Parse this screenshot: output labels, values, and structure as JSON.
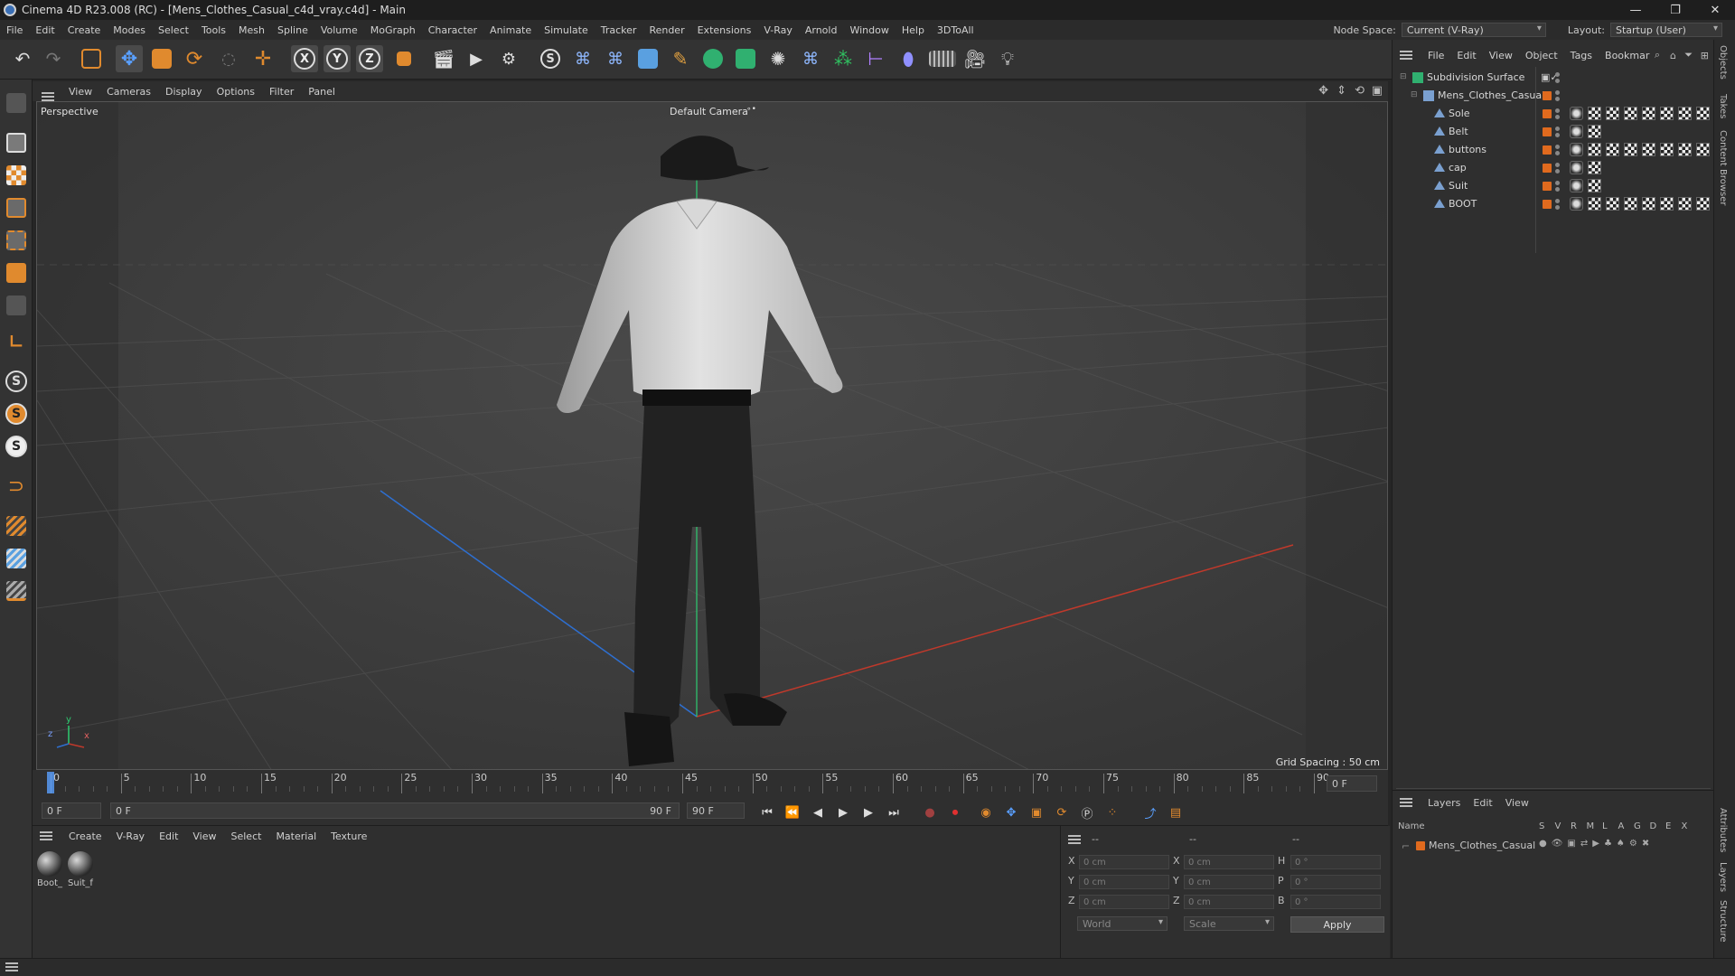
{
  "window": {
    "title": "Cinema 4D R23.008 (RC) - [Mens_Clothes_Casual_c4d_vray.c4d] - Main",
    "minimize": "—",
    "restore": "❐",
    "close": "✕"
  },
  "menubar": {
    "items": [
      "File",
      "Edit",
      "Create",
      "Modes",
      "Select",
      "Tools",
      "Mesh",
      "Spline",
      "Volume",
      "MoGraph",
      "Character",
      "Animate",
      "Simulate",
      "Tracker",
      "Render",
      "Extensions",
      "V-Ray",
      "Arnold",
      "Window",
      "Help",
      "3DToAll"
    ],
    "node_space_label": "Node Space:",
    "node_space_value": "Current (V-Ray)",
    "layout_label": "Layout:",
    "layout_value": "Startup (User)"
  },
  "toolbar": {
    "axis_x": "X",
    "axis_y": "Y",
    "axis_z": "Z"
  },
  "lefttoolbar": {
    "s1": "S",
    "s2": "S",
    "s3": "S"
  },
  "viewport": {
    "menu": [
      "View",
      "Cameras",
      "Display",
      "Options",
      "Filter",
      "Panel"
    ],
    "view_name": "Perspective",
    "camera_label": "Default Camera",
    "camera_suffix": "∘•",
    "grid_spacing": "Grid Spacing : 50 cm",
    "axis_y": "y",
    "axis_z": "z",
    "axis_x": "x"
  },
  "timeline": {
    "ticks": [
      "0",
      "5",
      "10",
      "15",
      "20",
      "25",
      "30",
      "35",
      "40",
      "45",
      "50",
      "55",
      "60",
      "65",
      "70",
      "75",
      "80",
      "85",
      "90"
    ],
    "current_frame": "0 F",
    "start_field": "0 F",
    "range_start": "0 F",
    "range_end": "90 F",
    "end_field": "90 F"
  },
  "materials": {
    "menu": [
      "Create",
      "V-Ray",
      "Edit",
      "View",
      "Select",
      "Material",
      "Texture"
    ],
    "items": [
      {
        "label": "Boot_"
      },
      {
        "label": "Suit_f"
      }
    ]
  },
  "coordinates": {
    "header": [
      "--",
      "--",
      "--"
    ],
    "rows": [
      {
        "axis": "X",
        "pos": "0 cm",
        "axis2": "X",
        "size": "0 cm",
        "rot_axis": "H",
        "rot": "0 °"
      },
      {
        "axis": "Y",
        "pos": "0 cm",
        "axis2": "Y",
        "size": "0 cm",
        "rot_axis": "P",
        "rot": "0 °"
      },
      {
        "axis": "Z",
        "pos": "0 cm",
        "axis2": "Z",
        "size": "0 cm",
        "rot_axis": "B",
        "rot": "0 °"
      }
    ],
    "mode": "World",
    "transform": "Scale",
    "apply_label": "Apply"
  },
  "objects": {
    "menu": [
      "File",
      "Edit",
      "View",
      "Object",
      "Tags",
      "Bookmar"
    ],
    "items": [
      {
        "name": "Subdivision Surface",
        "level": 0
      },
      {
        "name": "Mens_Clothes_Casual",
        "level": 1
      },
      {
        "name": "Sole",
        "level": 2,
        "tags": 8
      },
      {
        "name": "Belt",
        "level": 2,
        "tags": 2
      },
      {
        "name": "buttons",
        "level": 2,
        "tags": 8
      },
      {
        "name": "cap",
        "level": 2,
        "tags": 2
      },
      {
        "name": "Suit",
        "level": 2,
        "tags": 2
      },
      {
        "name": "BOOT",
        "level": 2,
        "tags": 8
      }
    ]
  },
  "layers": {
    "menu": [
      "Layers",
      "Edit",
      "View"
    ],
    "columns": [
      "Name",
      "S",
      "V",
      "R",
      "M",
      "L",
      "A",
      "G",
      "D",
      "E",
      "X"
    ],
    "rows": [
      {
        "name": "Mens_Clothes_Casual"
      }
    ]
  },
  "side_tabs": [
    "Objects",
    "Takes",
    "Content Browser",
    "Attributes",
    "Layers",
    "Structure"
  ],
  "colors": {
    "accent_orange": "#e06a1e",
    "axis_x": "#c0392b",
    "axis_y": "#2ecc71",
    "axis_z": "#2e6fd0",
    "layer_color": "#e06a1e"
  }
}
